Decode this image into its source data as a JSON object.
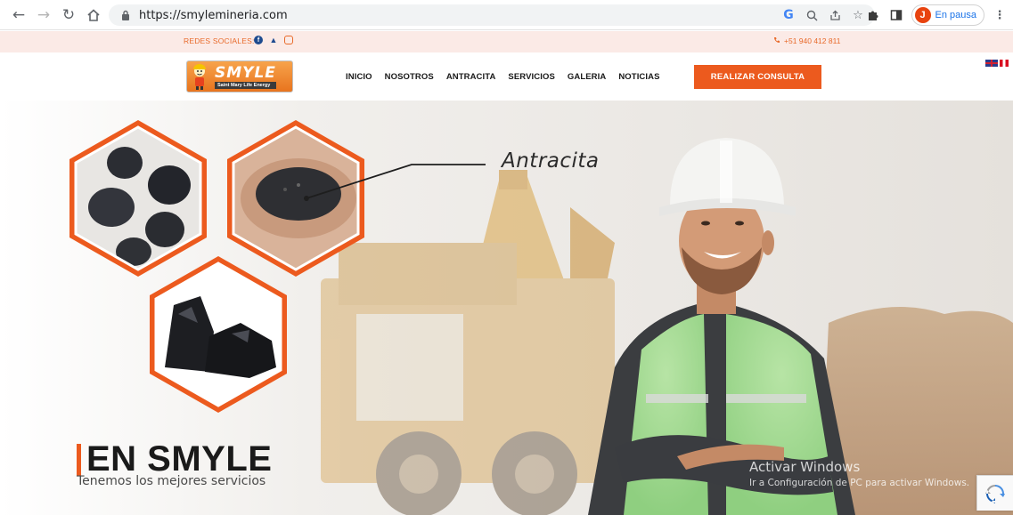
{
  "browser": {
    "url": "https://smylemineria.com",
    "profile_initial": "J",
    "profile_status": "En pausa"
  },
  "topbar": {
    "social_label": "REDES SOCIALES:",
    "phone": "+51 940 412 811"
  },
  "header": {
    "logo_name": "SMYLE",
    "logo_tagline": "Saint Mary Life Energy",
    "menu": [
      "INICIO",
      "NOSOTROS",
      "ANTRACITA",
      "SERVICIOS",
      "GALERIA",
      "NOTICIAS"
    ],
    "cta_label": "REALIZAR CONSULTA"
  },
  "hero": {
    "product_label": "Antracita",
    "title": "EN SMYLE",
    "subtitle": "Tenemos los mejores servicios",
    "accent_color": "#ec5a1e"
  },
  "overlay": {
    "activate_title": "Activar Windows",
    "activate_sub": "Ir a Configuración de PC para activar Windows."
  }
}
